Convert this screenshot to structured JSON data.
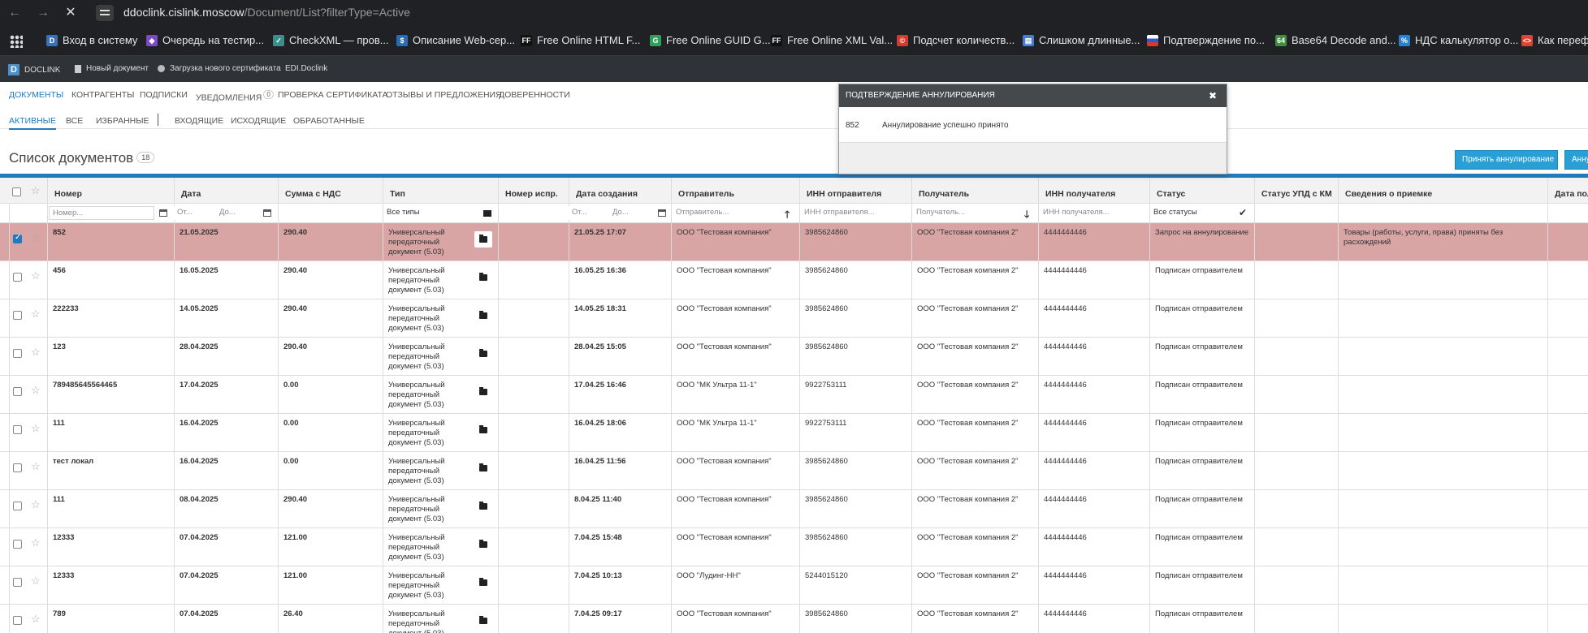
{
  "browser": {
    "url_host": "ddoclink.cislink.moscow",
    "url_path": "/Document/List?filterType=Active",
    "bookmarks": [
      {
        "label": "Вход в систему",
        "icon": "doclink-icon",
        "color": "#3b6fb6"
      },
      {
        "label": "Очередь на тестир...",
        "icon": "vs-icon",
        "color": "#7b4ac7"
      },
      {
        "label": "CheckXML — пров...",
        "icon": "checkxml-icon",
        "color": "#3a8f8a"
      },
      {
        "label": "Описание Web-сер...",
        "icon": "dollar-icon",
        "color": "#2b6cb0"
      },
      {
        "label": "Free Online HTML F...",
        "icon": "ff-icon",
        "color": "#111111"
      },
      {
        "label": "Free Online GUID G...",
        "icon": "guid-icon",
        "color": "#2e9e5b"
      },
      {
        "label": "Free Online XML Val...",
        "icon": "ff-icon",
        "color": "#111111"
      },
      {
        "label": "Подсчет количеств...",
        "icon": "copyright-icon",
        "color": "#d23b2f"
      },
      {
        "label": "Слишком длинные...",
        "icon": "book-icon",
        "color": "#4a7bd1"
      },
      {
        "label": "Подтверждение по...",
        "icon": "flag-ru-icon",
        "color": "#d33a2c"
      },
      {
        "label": "Base64 Decode and...",
        "icon": "b64-icon",
        "color": "#3f8f3f"
      },
      {
        "label": "НДС калькулятор о...",
        "icon": "percent-icon",
        "color": "#2c7fd0"
      },
      {
        "label": "Как перефор",
        "icon": "code-icon",
        "color": "#e0432f"
      }
    ]
  },
  "app": {
    "logo": "DOCLINK",
    "logo_letter": "D",
    "new_doc": "Новый документ",
    "upload_cert": "Загрузка нового сертификата",
    "edi": "EDI.Doclink"
  },
  "nav": {
    "items": [
      "ДОКУМЕНТЫ",
      "КОНТРАГЕНТЫ",
      "ПОДПИСКИ",
      "УВЕДОМЛЕНИЯ",
      "ПРОВЕРКА СЕРТИФИКАТА",
      "ОТЗЫВЫ И ПРЕДЛОЖЕНИЯ",
      "ДОВЕРЕННОСТИ"
    ],
    "notif_count": "0",
    "subtabs": [
      "АКТИВНЫЕ",
      "ВСЕ",
      "ИЗБРАННЫЕ",
      "ВХОДЯЩИЕ",
      "ИСХОДЯЩИЕ",
      "ОБРАБОТАННЫЕ"
    ]
  },
  "page": {
    "title": "Список документов",
    "count": "18",
    "accept_btn": "Принять аннулирование",
    "cancel_btn": "Анну"
  },
  "modal": {
    "title": "ПОДТВЕРЖДЕНИЕ АННУЛИРОВАНИЯ",
    "close": "✖",
    "number": "852",
    "message": "Аннулирование успешно принято"
  },
  "table": {
    "headers": [
      "Номер",
      "Дата",
      "Сумма с НДС",
      "Тип",
      "Номер испр.",
      "Дата создания",
      "Отправитель",
      "ИНН отправителя",
      "Получатель",
      "ИНН получателя",
      "Статус",
      "Статус УПД с КМ",
      "Сведения о приемке",
      "Дата пол"
    ],
    "filters": {
      "number": "Номер...",
      "date_from": "От...",
      "date_to": "До...",
      "type": "Все типы",
      "created_from": "От...",
      "created_to": "До...",
      "sender": "Отправитель...",
      "sender_inn": "ИНН отправителя...",
      "receiver": "Получатель...",
      "receiver_inn": "ИНН получателя...",
      "status": "Все статусы"
    },
    "rows": [
      {
        "number": "852",
        "date": "21.05.2025",
        "sum": "290.40",
        "type": "Универсальный передаточный документ (5.03)",
        "fix": "",
        "created": "21.05.25 17:07",
        "sender": "ООО \"Тестовая компания\"",
        "sender_inn": "3985624860",
        "receiver": "ООО \"Тестовая компания 2\"",
        "receiver_inn": "4444444446",
        "status": "Запрос на аннулирование",
        "upd_status": "",
        "acceptance": "Товары (работы, услуги, права) приняты без расхождений",
        "selected": true
      },
      {
        "number": "456",
        "date": "16.05.2025",
        "sum": "290.40",
        "type": "Универсальный передаточный документ (5.03)",
        "fix": "",
        "created": "16.05.25 16:36",
        "sender": "ООО \"Тестовая компания\"",
        "sender_inn": "3985624860",
        "receiver": "ООО \"Тестовая компания 2\"",
        "receiver_inn": "4444444446",
        "status": "Подписан отправителем",
        "upd_status": "",
        "acceptance": "",
        "selected": false
      },
      {
        "number": "222233",
        "date": "14.05.2025",
        "sum": "290.40",
        "type": "Универсальный передаточный документ (5.03)",
        "fix": "",
        "created": "14.05.25 18:31",
        "sender": "ООО \"Тестовая компания\"",
        "sender_inn": "3985624860",
        "receiver": "ООО \"Тестовая компания 2\"",
        "receiver_inn": "4444444446",
        "status": "Подписан отправителем",
        "upd_status": "",
        "acceptance": "",
        "selected": false
      },
      {
        "number": "123",
        "date": "28.04.2025",
        "sum": "290.40",
        "type": "Универсальный передаточный документ (5.03)",
        "fix": "",
        "created": "28.04.25 15:05",
        "sender": "ООО \"Тестовая компания\"",
        "sender_inn": "3985624860",
        "receiver": "ООО \"Тестовая компания 2\"",
        "receiver_inn": "4444444446",
        "status": "Подписан отправителем",
        "upd_status": "",
        "acceptance": "",
        "selected": false
      },
      {
        "number": "789485645564465",
        "date": "17.04.2025",
        "sum": "0.00",
        "type": "Универсальный передаточный документ (5.03)",
        "fix": "",
        "created": "17.04.25 16:46",
        "sender": "ООО \"МК Ультра 11-1\"",
        "sender_inn": "9922753111",
        "receiver": "ООО \"Тестовая компания 2\"",
        "receiver_inn": "4444444446",
        "status": "Подписан отправителем",
        "upd_status": "",
        "acceptance": "",
        "selected": false
      },
      {
        "number": "111",
        "date": "16.04.2025",
        "sum": "0.00",
        "type": "Универсальный передаточный документ (5.03)",
        "fix": "",
        "created": "16.04.25 18:06",
        "sender": "ООО \"МК Ультра 11-1\"",
        "sender_inn": "9922753111",
        "receiver": "ООО \"Тестовая компания 2\"",
        "receiver_inn": "4444444446",
        "status": "Подписан отправителем",
        "upd_status": "",
        "acceptance": "",
        "selected": false
      },
      {
        "number": "тест локал",
        "date": "16.04.2025",
        "sum": "0.00",
        "type": "Универсальный передаточный документ (5.03)",
        "fix": "",
        "created": "16.04.25 11:56",
        "sender": "ООО \"Тестовая компания\"",
        "sender_inn": "3985624860",
        "receiver": "ООО \"Тестовая компания 2\"",
        "receiver_inn": "4444444446",
        "status": "Подписан отправителем",
        "upd_status": "",
        "acceptance": "",
        "selected": false
      },
      {
        "number": "111",
        "date": "08.04.2025",
        "sum": "290.40",
        "type": "Универсальный передаточный документ (5.03)",
        "fix": "",
        "created": "8.04.25 11:40",
        "sender": "ООО \"Тестовая компания\"",
        "sender_inn": "3985624860",
        "receiver": "ООО \"Тестовая компания 2\"",
        "receiver_inn": "4444444446",
        "status": "Подписан отправителем",
        "upd_status": "",
        "acceptance": "",
        "selected": false
      },
      {
        "number": "12333",
        "date": "07.04.2025",
        "sum": "121.00",
        "type": "Универсальный передаточный документ (5.03)",
        "fix": "",
        "created": "7.04.25 15:48",
        "sender": "ООО \"Тестовая компания\"",
        "sender_inn": "3985624860",
        "receiver": "ООО \"Тестовая компания 2\"",
        "receiver_inn": "4444444446",
        "status": "Подписан отправителем",
        "upd_status": "",
        "acceptance": "",
        "selected": false
      },
      {
        "number": "12333",
        "date": "07.04.2025",
        "sum": "121.00",
        "type": "Универсальный передаточный документ (5.03)",
        "fix": "",
        "created": "7.04.25 10:13",
        "sender": "ООО \"Лудинг-НН\"",
        "sender_inn": "5244015120",
        "receiver": "ООО \"Тестовая компания 2\"",
        "receiver_inn": "4444444446",
        "status": "Подписан отправителем",
        "upd_status": "",
        "acceptance": "",
        "selected": false
      },
      {
        "number": "789",
        "date": "07.04.2025",
        "sum": "26.40",
        "type": "Универсальный передаточный документ (5.03)",
        "fix": "",
        "created": "7.04.25 09:17",
        "sender": "ООО \"Тестовая компания\"",
        "sender_inn": "3985624860",
        "receiver": "ООО \"Тестовая компания 2\"",
        "receiver_inn": "4444444446",
        "status": "Подписан отправителем",
        "upd_status": "",
        "acceptance": "",
        "selected": false
      }
    ]
  }
}
